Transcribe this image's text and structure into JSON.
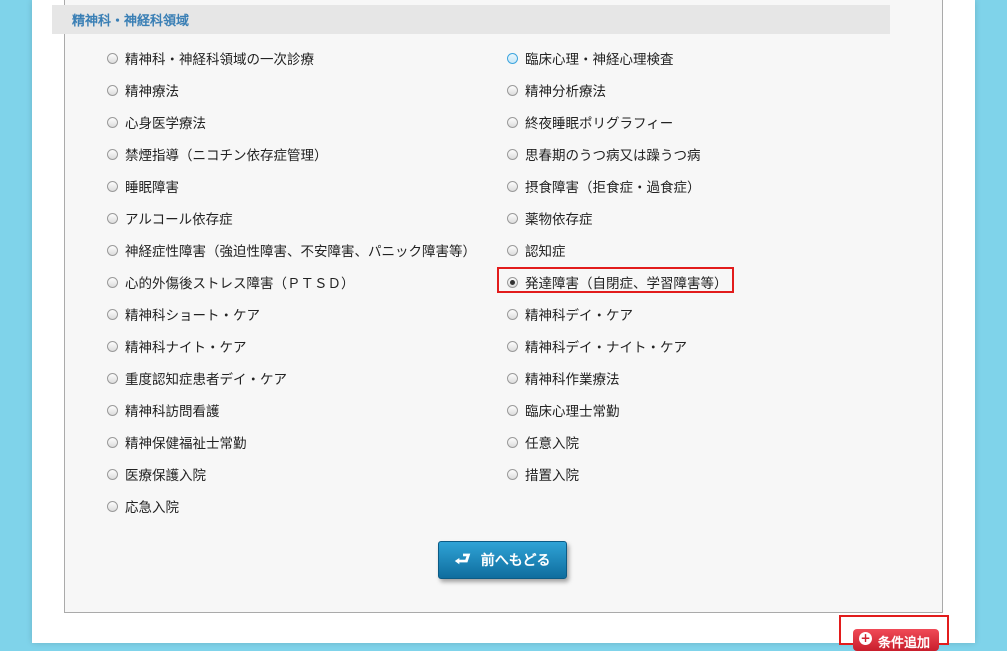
{
  "section": {
    "title": "精神科・神経科領域"
  },
  "options": [
    {
      "label": "精神科・神経科領域の一次診療",
      "checked": false
    },
    {
      "label": "臨床心理・神経心理検査",
      "checked": false
    },
    {
      "label": "精神療法",
      "checked": false
    },
    {
      "label": "精神分析療法",
      "checked": false
    },
    {
      "label": "心身医学療法",
      "checked": false
    },
    {
      "label": "終夜睡眠ポリグラフィー",
      "checked": false
    },
    {
      "label": "禁煙指導（ニコチン依存症管理）",
      "checked": false
    },
    {
      "label": "思春期のうつ病又は躁うつ病",
      "checked": false
    },
    {
      "label": "睡眠障害",
      "checked": false
    },
    {
      "label": "摂食障害（拒食症・過食症）",
      "checked": false
    },
    {
      "label": "アルコール依存症",
      "checked": false
    },
    {
      "label": "薬物依存症",
      "checked": false
    },
    {
      "label": "神経症性障害（強迫性障害、不安障害、パニック障害等）",
      "checked": false
    },
    {
      "label": "認知症",
      "checked": false
    },
    {
      "label": "心的外傷後ストレス障害（ＰＴＳＤ）",
      "checked": false
    },
    {
      "label": "発達障害（自閉症、学習障害等）",
      "checked": true
    },
    {
      "label": "精神科ショート・ケア",
      "checked": false
    },
    {
      "label": "精神科デイ・ケア",
      "checked": false
    },
    {
      "label": "精神科ナイト・ケア",
      "checked": false
    },
    {
      "label": "精神科デイ・ナイト・ケア",
      "checked": false
    },
    {
      "label": "重度認知症患者デイ・ケア",
      "checked": false
    },
    {
      "label": "精神科作業療法",
      "checked": false
    },
    {
      "label": "精神科訪問看護",
      "checked": false
    },
    {
      "label": "臨床心理士常勤",
      "checked": false
    },
    {
      "label": "精神保健福祉士常勤",
      "checked": false
    },
    {
      "label": "任意入院",
      "checked": false
    },
    {
      "label": "医療保護入院",
      "checked": false
    },
    {
      "label": "措置入院",
      "checked": false
    },
    {
      "label": "応急入院",
      "checked": false
    }
  ],
  "buttons": {
    "back_label": "前へもどる",
    "add_label": "条件追加"
  },
  "colors": {
    "background": "#7fd3ea",
    "section_title": "#3a7fb5",
    "highlight": "#e21c1c",
    "back_button": "#1a87bd",
    "add_button": "#d9303d"
  }
}
